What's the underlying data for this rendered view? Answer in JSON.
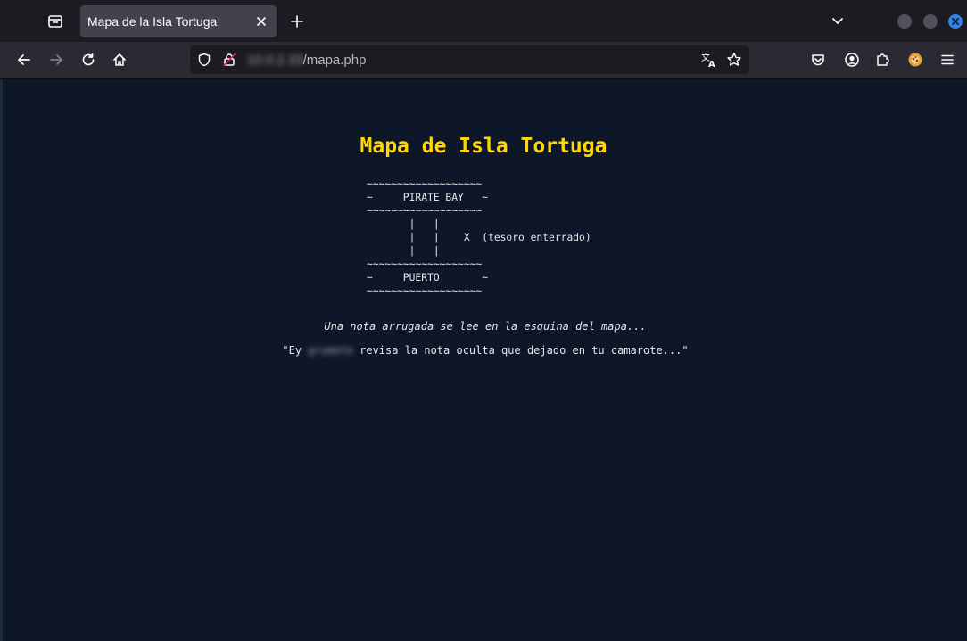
{
  "browser": {
    "tab": {
      "title": "Mapa de la Isla Tortuga"
    },
    "url": {
      "host": "10.0.2.33",
      "path": "/mapa.php"
    },
    "icons": {
      "tab_list": "tab-list-icon",
      "tab_close": "close-icon",
      "new_tab": "plus-icon",
      "tabs_dropdown": "chevron-down-icon",
      "back": "arrow-left-icon",
      "forward": "arrow-right-icon",
      "reload": "reload-icon",
      "home": "home-icon",
      "tracking": "shield-icon",
      "insecure": "lock-slash-icon",
      "translate": "translate-icon",
      "bookmark": "star-icon",
      "pocket": "pocket-icon",
      "account": "account-icon",
      "extensions": "puzzle-icon",
      "extension": "extension-icon",
      "menu": "hamburger-menu-icon"
    },
    "colors": {
      "chrome": "#1c1b22",
      "toolbar": "#2b2a33",
      "close_button": "#3584e4"
    }
  },
  "page": {
    "background": "#0d1729",
    "title": "Mapa de Isla Tortuga",
    "title_color": "#ffd700",
    "map_lines": [
      "~~~~~~~~~~~~~~~~~~~",
      "~     PIRATE BAY   ~",
      "~~~~~~~~~~~~~~~~~~~",
      "       |   |",
      "       |   |    X  (tesoro enterrado)",
      "       |   |",
      "~~~~~~~~~~~~~~~~~~~",
      "~     PUERTO       ~",
      "~~~~~~~~~~~~~~~~~~~"
    ],
    "note_intro": "Una nota arrugada se lee en la esquina del mapa...",
    "note_quote": {
      "prefix": "\"Ey ",
      "name": "grumete",
      "suffix": " revisa la nota oculta que dejado en tu camarote...\""
    }
  }
}
